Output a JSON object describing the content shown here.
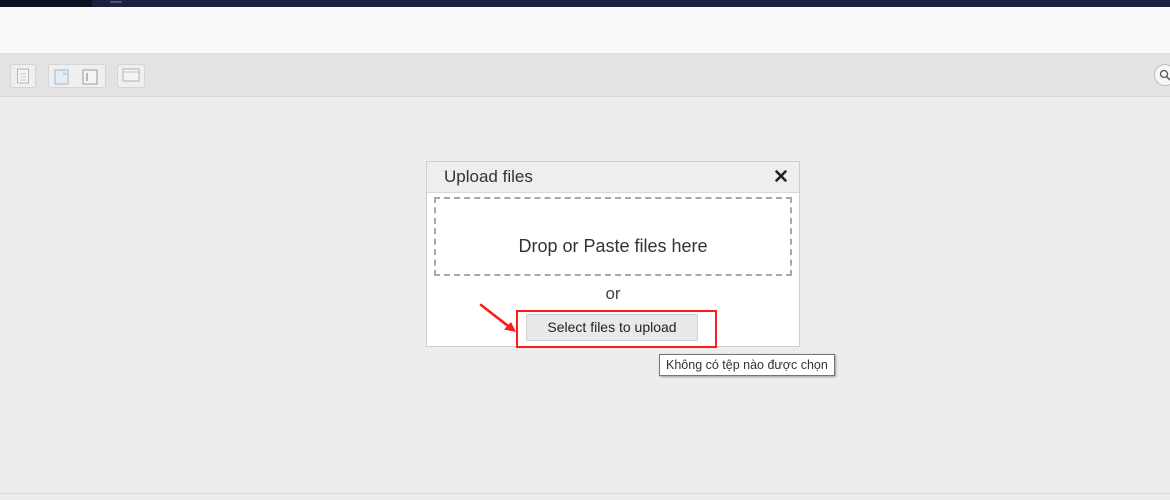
{
  "dialog": {
    "title": "Upload files",
    "dropzone_text": "Drop or Paste files here",
    "or_text": "or",
    "select_button_label": "Select files to upload"
  },
  "tooltip": {
    "text": "Không có tệp nào được chọn"
  },
  "toolbar": {
    "icons": [
      "document-icon",
      "page-icon",
      "frame-icon",
      "panel-icon"
    ],
    "search_icon": "search-icon"
  },
  "colors": {
    "highlight": "#ff1a1a",
    "top_strip": "#1b2240"
  }
}
